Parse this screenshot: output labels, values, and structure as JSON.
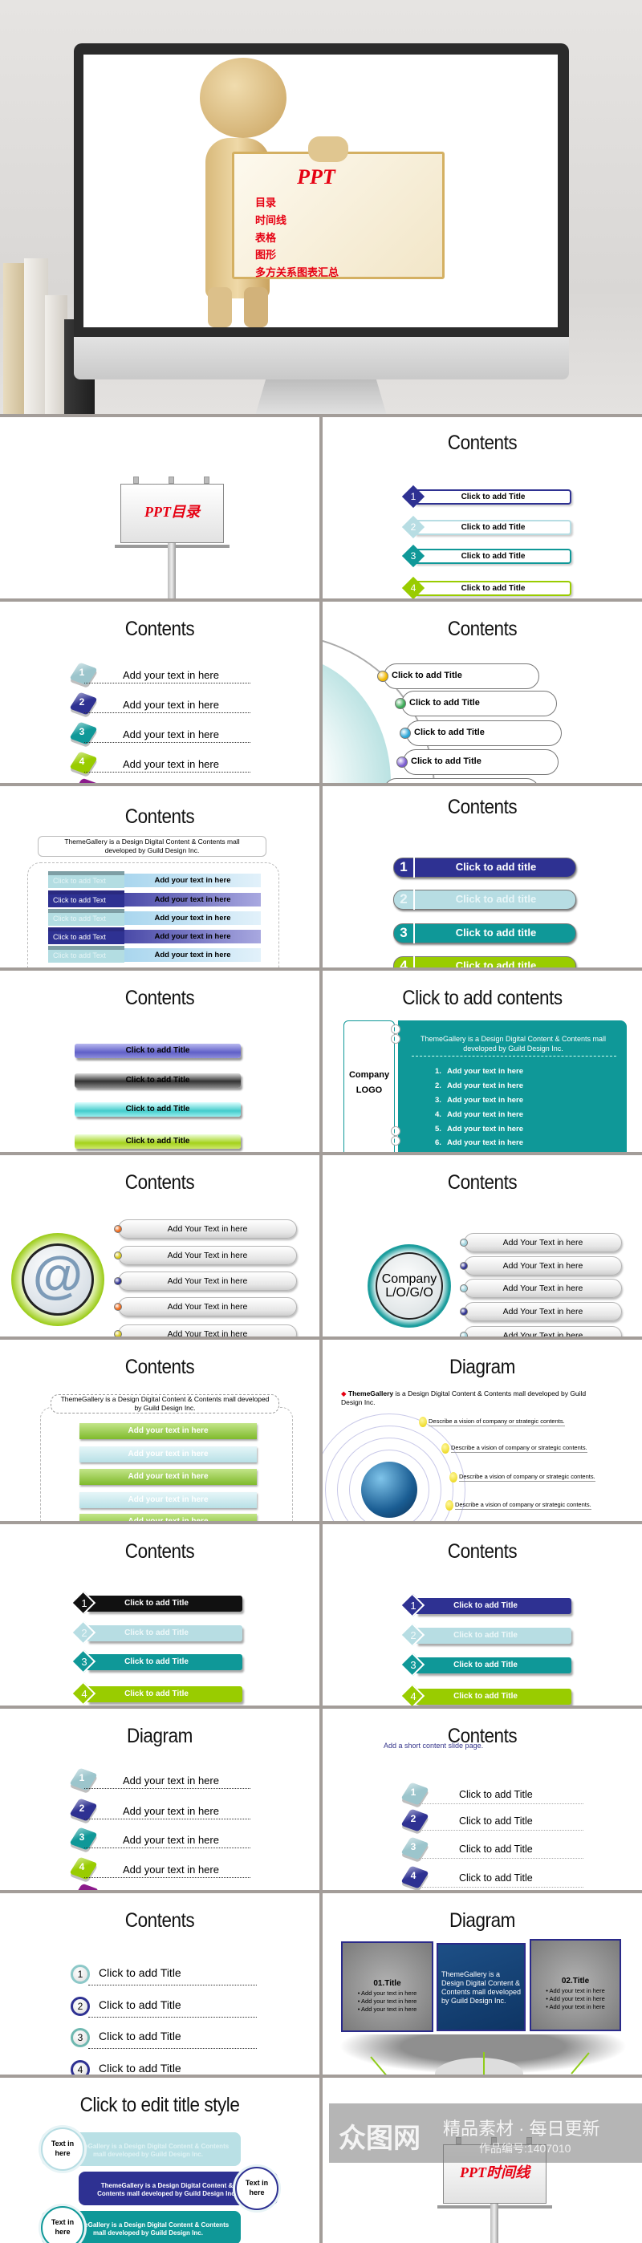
{
  "colors": {
    "navy": "#2e3192",
    "light_blue": "#b7dde3",
    "teal": "#0f9898",
    "lime": "#99cc00",
    "black": "#111111",
    "red": "#e60012",
    "purple": "#8b1a8b",
    "divider": "#a39d99"
  },
  "hero": {
    "sign_title": "PPT",
    "menu": [
      "目录",
      "时间线",
      "表格",
      "图形",
      "多方关系图表汇总"
    ]
  },
  "slides": {
    "s1": {
      "billboard_text": "PPT目录"
    },
    "s2": {
      "title": "Contents",
      "items": [
        {
          "n": "1",
          "label": "Click to add Title"
        },
        {
          "n": "2",
          "label": "Click to add Title"
        },
        {
          "n": "3",
          "label": "Click to add Title"
        },
        {
          "n": "4",
          "label": "Click to add Title"
        }
      ]
    },
    "s3": {
      "title": "Contents",
      "items": [
        {
          "n": "1",
          "label": "Add your text in here"
        },
        {
          "n": "2",
          "label": "Add your text in here"
        },
        {
          "n": "3",
          "label": "Add your text in here"
        },
        {
          "n": "4",
          "label": "Add your text in here"
        }
      ]
    },
    "s4": {
      "title": "Contents",
      "items": [
        "Click to add Title",
        "Click to add Title",
        "Click to add Title",
        "Click to add Title"
      ]
    },
    "s5": {
      "title": "Contents",
      "intro": "ThemeGallery is a Design Digital Content & Contents mall developed by Guild Design Inc.",
      "rows": [
        {
          "left": "Click to add Text",
          "right": "Add your text in here"
        },
        {
          "left": "Click to add Text",
          "right": "Add your text in here"
        },
        {
          "left": "Click to add Text",
          "right": "Add your text in here"
        },
        {
          "left": "Click to add Text",
          "right": "Add your text in here"
        },
        {
          "left": "Click to add Text",
          "right": "Add your text in here"
        }
      ]
    },
    "s6": {
      "title": "Contents",
      "items": [
        {
          "n": "1",
          "label": "Click to add title"
        },
        {
          "n": "2",
          "label": "Click to add title"
        },
        {
          "n": "3",
          "label": "Click to add title"
        },
        {
          "n": "4",
          "label": "Click to add title"
        }
      ]
    },
    "s7": {
      "title": "Contents",
      "items": [
        "Click to add Title",
        "Click to add Title",
        "Click to add Title",
        "Click to add Title"
      ]
    },
    "s8": {
      "title": "Click to add contents",
      "logo_line1": "Company",
      "logo_line2": "LOGO",
      "intro": "ThemeGallery is a Design Digital Content & Contents mall developed by Guild Design Inc.",
      "items": [
        {
          "n": "1.",
          "label": "Add your text in here"
        },
        {
          "n": "2.",
          "label": "Add your text in here"
        },
        {
          "n": "3.",
          "label": "Add your text in here"
        },
        {
          "n": "4.",
          "label": "Add your text in here"
        },
        {
          "n": "5.",
          "label": "Add your text in here"
        },
        {
          "n": "6.",
          "label": "Add your text in here"
        }
      ]
    },
    "s9": {
      "title": "Contents",
      "center_glyph": "@",
      "items": [
        "Add Your Text in here",
        "Add Your Text in here",
        "Add Your Text in here",
        "Add Your Text in here",
        "Add Your Text in here"
      ]
    },
    "s10": {
      "title": "Contents",
      "logo_line1": "Company",
      "logo_line2": "L/O/G/O",
      "items": [
        "Add Your Text in here",
        "Add Your Text in here",
        "Add Your Text in here",
        "Add Your Text in here",
        "Add Your Text in here"
      ]
    },
    "s11": {
      "title": "Contents",
      "intro": "ThemeGallery is a Design Digital Content & Contents mall developed by Guild Design Inc.",
      "items": [
        "Add your text in here",
        "Add your text in here",
        "Add your text in here",
        "Add your text in here",
        "Add your text in here"
      ]
    },
    "s12": {
      "title": "Diagram",
      "intro_bold": "ThemeGallery",
      "intro": " is a Design Digital Content & Contents mall developed by Guild Design Inc.",
      "items": [
        "Describe a vision of company or strategic contents.",
        "Describe a vision of company or strategic contents.",
        "Describe a vision of company or strategic contents.",
        "Describe a vision of company or strategic contents."
      ]
    },
    "s13": {
      "title": "Contents",
      "items": [
        {
          "n": "1",
          "label": "Click to add Title"
        },
        {
          "n": "2",
          "label": "Click to add Title"
        },
        {
          "n": "3",
          "label": "Click to add Title"
        },
        {
          "n": "4",
          "label": "Click to add Title"
        }
      ]
    },
    "s14": {
      "title": "Contents",
      "items": [
        {
          "n": "1",
          "label": "Click to add Title"
        },
        {
          "n": "2",
          "label": "Click to add Title"
        },
        {
          "n": "3",
          "label": "Click to add Title"
        },
        {
          "n": "4",
          "label": "Click to add Title"
        }
      ]
    },
    "s15": {
      "title": "Diagram",
      "items": [
        {
          "n": "1",
          "label": "Add your text in here"
        },
        {
          "n": "2",
          "label": "Add your text in here"
        },
        {
          "n": "3",
          "label": "Add your text in here"
        },
        {
          "n": "4",
          "label": "Add your text in here"
        }
      ]
    },
    "s16": {
      "title": "Contents",
      "subtitle": "Add a short content slide page.",
      "items": [
        {
          "n": "1",
          "label": "Click to add Title"
        },
        {
          "n": "2",
          "label": "Click to add Title"
        },
        {
          "n": "3",
          "label": "Click to add Title"
        },
        {
          "n": "4",
          "label": "Click to add Title"
        }
      ]
    },
    "s17": {
      "title": "Contents",
      "items": [
        {
          "n": "1",
          "label": "Click to add Title"
        },
        {
          "n": "2",
          "label": "Click to add Title"
        },
        {
          "n": "3",
          "label": "Click to add Title"
        },
        {
          "n": "4",
          "label": "Click to add Title"
        }
      ]
    },
    "s18": {
      "title": "Diagram",
      "left_panel": {
        "heading": "01.Title",
        "bullets": [
          "• Add your text in here",
          "• Add your text in here",
          "• Add your text in here"
        ]
      },
      "center_panel": {
        "text": "ThemeGallery is a Design Digital Content & Contents mall developed by Guild Design Inc."
      },
      "right_panel": {
        "heading": "02.Title",
        "bullets": [
          "• Add your text in here",
          "• Add your text in here",
          "• Add your text in here"
        ]
      }
    },
    "s19": {
      "title": "Click to edit title style",
      "bands": [
        {
          "circle": "Text in here",
          "text": "ThemeGallery is a Design Digital Content & Contents mall developed by Guild Design Inc."
        },
        {
          "circle": "Text in here",
          "text": "ThemeGallery is a Design Digital Content & Contents mall developed by Guild Design Inc."
        },
        {
          "circle": "Text in here",
          "text": "ThemeGallery is a Design Digital Content & Contents mall developed by Guild Design Inc."
        }
      ]
    },
    "s20": {
      "billboard_text": "PPT时间线"
    }
  },
  "watermark": {
    "logo": "众图网",
    "slogan": "精品素材 · 每日更新",
    "code": "作品编号:1407010"
  }
}
